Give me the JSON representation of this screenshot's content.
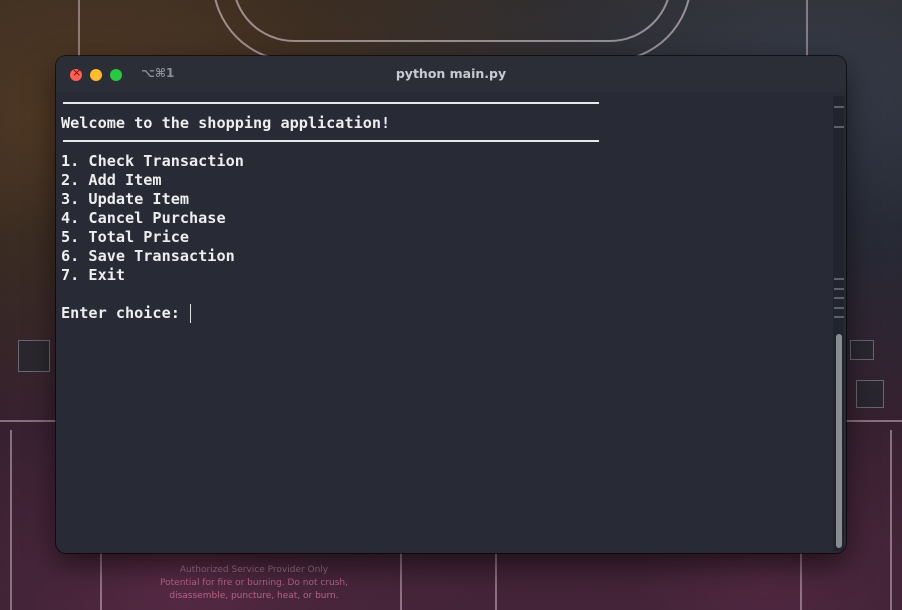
{
  "window": {
    "title": "python main.py",
    "shortcut": "⌥⌘1"
  },
  "terminal": {
    "welcome": "Welcome to the shopping application!",
    "menu_items": [
      "1. Check Transaction",
      "2. Add Item",
      "3. Update Item",
      "4. Cancel Purchase",
      "5. Total Price",
      "6. Save Transaction",
      "7. Exit"
    ],
    "prompt": "Enter choice: "
  },
  "wallpaper": {
    "warning_lines": [
      "Authorized Service Provider Only",
      "Potential for fire or burning. Do not crush,",
      "disassemble, puncture, heat, or burn."
    ]
  },
  "colors": {
    "terminal_bg": "#282a36",
    "text": "#eeeeef",
    "close": "#fe5f57",
    "minimize": "#febc2e",
    "zoom": "#28c840"
  }
}
